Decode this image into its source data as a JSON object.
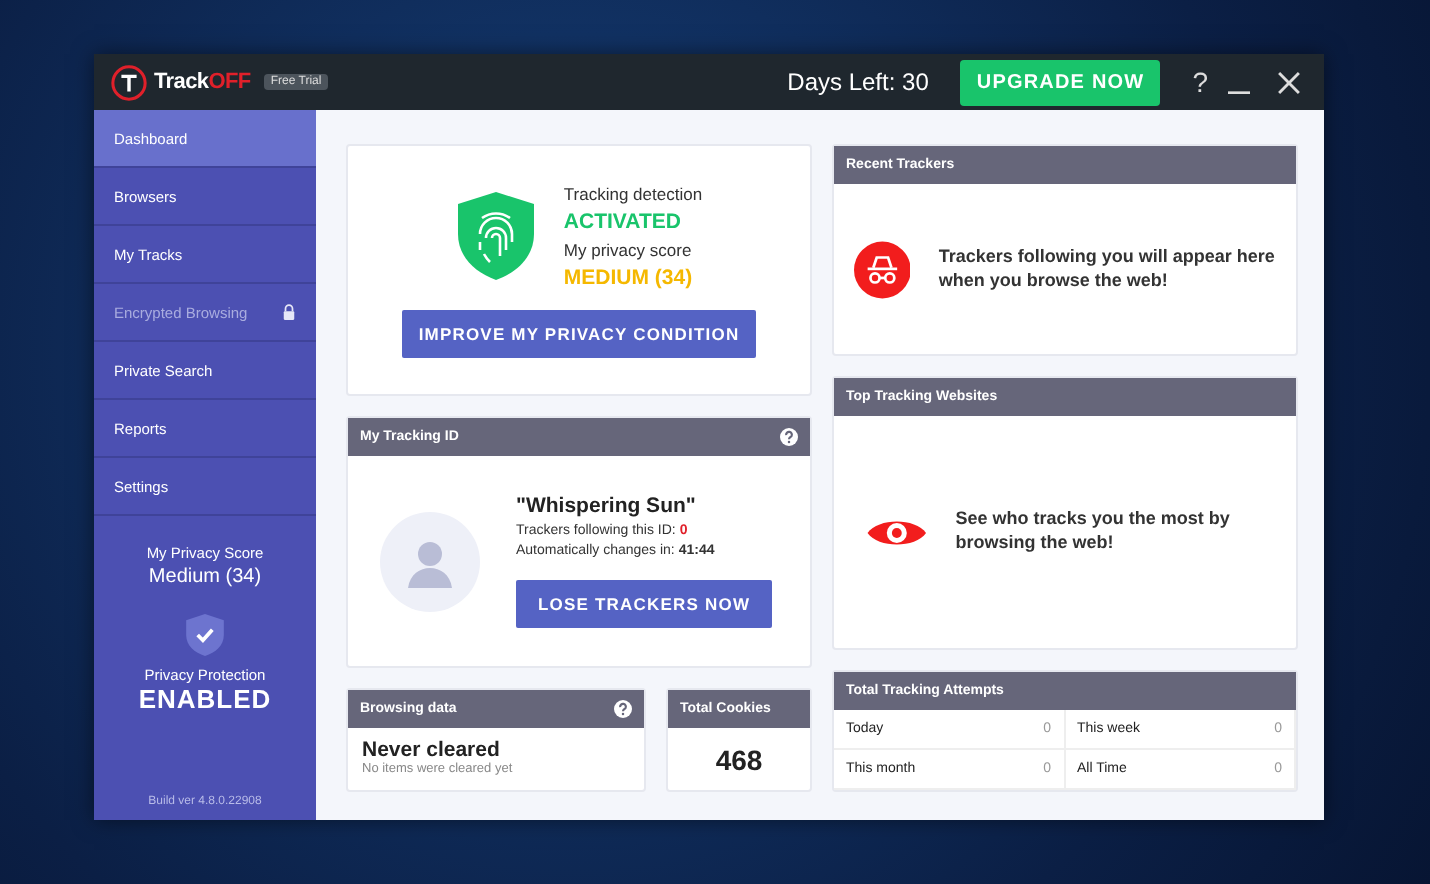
{
  "titlebar": {
    "logo": {
      "part_1": "Track",
      "part_2": "OFF"
    },
    "badge": "Free Trial",
    "days_left": "Days Left: 30",
    "upgrade_button": "UPGRADE NOW",
    "help": "?"
  },
  "sidebar": {
    "items": [
      {
        "label": "Dashboard",
        "selected": true,
        "locked": false
      },
      {
        "label": "Browsers",
        "selected": false,
        "locked": false
      },
      {
        "label": "My Tracks",
        "selected": false,
        "locked": false
      },
      {
        "label": "Encrypted Browsing",
        "selected": false,
        "locked": true
      },
      {
        "label": "Private Search",
        "selected": false,
        "locked": false
      },
      {
        "label": "Reports",
        "selected": false,
        "locked": false
      },
      {
        "label": "Settings",
        "selected": false,
        "locked": false
      }
    ],
    "score_label": "My Privacy Score",
    "score_value": "Medium (34)",
    "protection_label": "Privacy Protection",
    "protection_status": "ENABLED",
    "build": "Build ver  4.8.0.22908"
  },
  "status_card": {
    "detection_label": "Tracking detection",
    "detection_value": "ACTIVATED",
    "score_label": "My privacy score",
    "score_value": "MEDIUM (34)",
    "button": "IMPROVE MY PRIVACY CONDITION"
  },
  "tracking_id": {
    "title": "My Tracking ID",
    "name": "\"Whispering Sun\"",
    "trackers_label": "Trackers following this ID:",
    "trackers_value": "0",
    "changes_label": "Automatically changes in:",
    "changes_value": "41:44",
    "button": "LOSE TRACKERS NOW"
  },
  "browsing_data": {
    "title": "Browsing data",
    "status": "Never cleared",
    "detail": "No items were cleared yet"
  },
  "total_cookies": {
    "title": "Total Cookies",
    "value": "468"
  },
  "recent_trackers": {
    "title": "Recent Trackers",
    "message": "Trackers following you will appear here when you browse the web!"
  },
  "top_websites": {
    "title": "Top Tracking Websites",
    "message": "See who tracks you the most by browsing the web!"
  },
  "tracking_attempts": {
    "title": "Total Tracking Attempts",
    "cells": [
      {
        "label": "Today",
        "value": "0"
      },
      {
        "label": "This week",
        "value": "0"
      },
      {
        "label": "This month",
        "value": "0"
      },
      {
        "label": "All Time",
        "value": "0"
      }
    ]
  }
}
